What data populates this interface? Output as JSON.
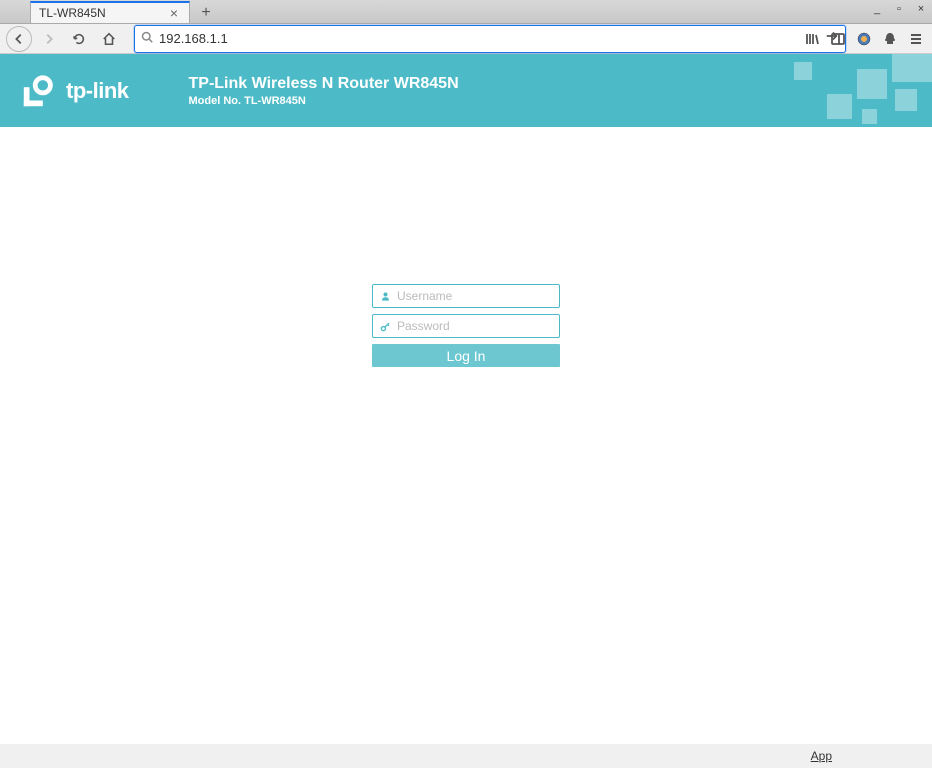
{
  "browser": {
    "tab_title": "TL-WR845N",
    "url": "192.168.1.1"
  },
  "header": {
    "logo_text": "tp-link",
    "title": "TP-Link Wireless N Router WR845N",
    "subtitle": "Model No. TL-WR845N"
  },
  "login": {
    "username_placeholder": "Username",
    "password_placeholder": "Password",
    "button_label": "Log In"
  },
  "footer": {
    "app_link": "App"
  }
}
